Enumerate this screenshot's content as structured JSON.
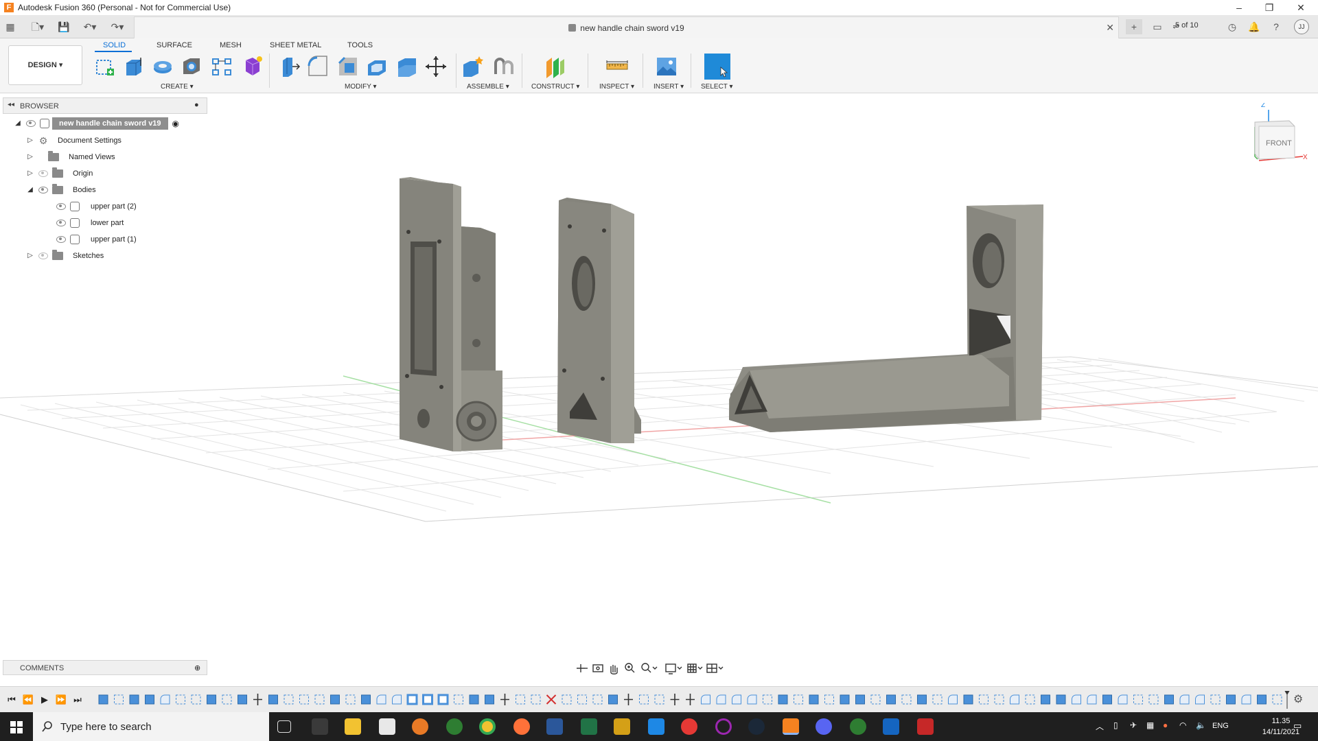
{
  "window": {
    "title": "Autodesk Fusion 360 (Personal - Not for Commercial Use)",
    "logo_letter": "F"
  },
  "document": {
    "tab_title": "new handle chain sword v19",
    "jobs_counter": "5 of 10",
    "user_initials": "JJ"
  },
  "workspace": {
    "mode_label": "DESIGN",
    "tabs": [
      {
        "label": "SOLID",
        "active": true
      },
      {
        "label": "SURFACE",
        "active": false
      },
      {
        "label": "MESH",
        "active": false
      },
      {
        "label": "SHEET METAL",
        "active": false
      },
      {
        "label": "TOOLS",
        "active": false
      }
    ],
    "groups": {
      "create": "CREATE",
      "modify": "MODIFY",
      "assemble": "ASSEMBLE",
      "construct": "CONSTRUCT",
      "inspect": "INSPECT",
      "insert": "INSERT",
      "select": "SELECT"
    }
  },
  "browser": {
    "header": "BROWSER",
    "root": "new handle chain sword v19",
    "items": {
      "document_settings": "Document Settings",
      "named_views": "Named Views",
      "origin": "Origin",
      "bodies": "Bodies",
      "body1": "upper part (2)",
      "body2": "lower part",
      "body3": "upper part (1)",
      "sketches": "Sketches"
    }
  },
  "viewcube": {
    "face_label": "FRONT",
    "axis_z": "Z",
    "axis_x": "X"
  },
  "comments": {
    "header": "COMMENTS"
  },
  "taskbar": {
    "search_placeholder": "Type here to search",
    "language": "ENG",
    "time": "11.35",
    "date": "14/11/2021"
  },
  "colors": {
    "accent": "#0a6fd6",
    "model_gray": "#86857d",
    "fusion_orange": "#f58220"
  }
}
